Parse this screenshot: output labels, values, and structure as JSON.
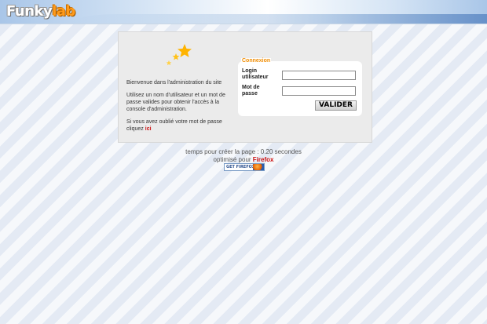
{
  "header": {
    "logo_funky": "Funky",
    "logo_lab": "lab"
  },
  "intro": {
    "welcome": "Bienvenue dans l'administration du site",
    "instructions": "Utilisez un nom d'utilisateur et un mot de passe valides pour obtenir l'accès à la console d'administration.",
    "forgot_text": "Si vous avez oublié votre mot de passe cliquez",
    "forgot_link": "ici"
  },
  "login": {
    "legend": "Connexion",
    "login_label_line1": "Login",
    "login_label_line2": "utilisateur",
    "login_value": "",
    "password_label_line1": "Mot de",
    "password_label_line2": "passe",
    "password_value": "",
    "submit_label": "VALIDER"
  },
  "footer": {
    "timing": "temps pour créer la page : 0.20 secondes",
    "optimized_prefix": "optimisé pour",
    "browser": "Firefox",
    "badge": "GET FIREFOX"
  },
  "colors": {
    "accent_orange": "#f08c00",
    "link_red": "#cc1111"
  },
  "icons": [
    "stars-icon",
    "firefox-globe-icon"
  ]
}
